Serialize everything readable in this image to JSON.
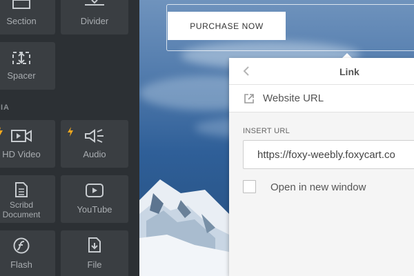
{
  "sidebar": {
    "tiles": {
      "section": "Section",
      "divider": "Divider",
      "spacer": "Spacer",
      "hd_video": "HD Video",
      "audio": "Audio",
      "scribd": "Scribd\nDocument",
      "youtube": "YouTube",
      "flash": "Flash",
      "file": "File"
    },
    "media_heading": "DIA",
    "icons": [
      "section-icon",
      "divider-icon",
      "spacer-icon",
      "video-icon",
      "audio-icon",
      "document-icon",
      "youtube-icon",
      "flash-icon",
      "file-icon",
      "bolt-icon"
    ],
    "accent": "#f0a81e"
  },
  "canvas": {
    "purchase_button": "PURCHASE NOW"
  },
  "link_popover": {
    "title": "Link",
    "type_label": "Website URL",
    "field_label": "INSERT URL",
    "url_value": "https://foxy-weebly.foxycart.co",
    "checkbox_label": "Open in new window",
    "checkbox_checked": false
  }
}
